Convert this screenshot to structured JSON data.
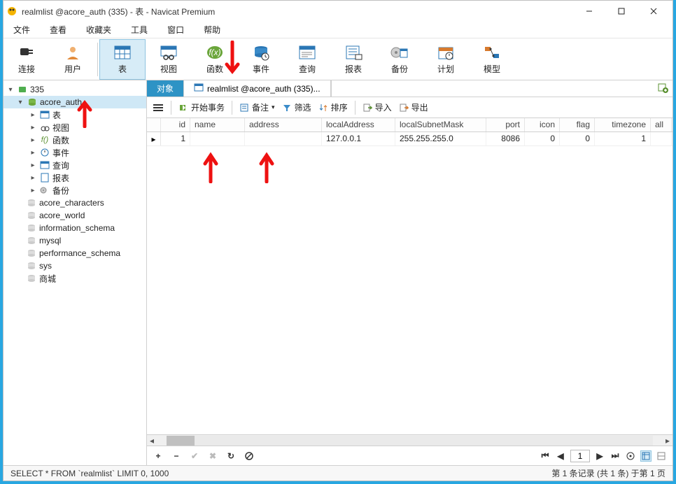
{
  "window": {
    "title": "realmlist @acore_auth (335) - 表 - Navicat Premium"
  },
  "menu": [
    "文件",
    "查看",
    "收藏夹",
    "工具",
    "窗口",
    "帮助"
  ],
  "toolbar": [
    {
      "label": "连接",
      "icon": "connection"
    },
    {
      "label": "用户",
      "icon": "user"
    },
    {
      "label": "表",
      "icon": "table",
      "active": true
    },
    {
      "label": "视图",
      "icon": "view"
    },
    {
      "label": "函数",
      "icon": "fx"
    },
    {
      "label": "事件",
      "icon": "event"
    },
    {
      "label": "查询",
      "icon": "query"
    },
    {
      "label": "报表",
      "icon": "report"
    },
    {
      "label": "备份",
      "icon": "backup"
    },
    {
      "label": "计划",
      "icon": "schedule"
    },
    {
      "label": "模型",
      "icon": "model"
    }
  ],
  "tree": {
    "conn": "335",
    "db_selected": "acore_auth",
    "children": [
      "表",
      "视图",
      "函数",
      "事件",
      "查询",
      "报表",
      "备份"
    ],
    "dbs": [
      "acore_characters",
      "acore_world",
      "information_schema",
      "mysql",
      "performance_schema",
      "sys",
      "商城"
    ]
  },
  "tabs": {
    "t0": "对象",
    "t1": "realmlist @acore_auth (335)..."
  },
  "subtoolbar": {
    "begin_tx": "开始事务",
    "memo": "备注",
    "filter": "筛选",
    "sort": "排序",
    "import": "导入",
    "export": "导出"
  },
  "grid": {
    "columns": [
      "id",
      "name",
      "address",
      "localAddress",
      "localSubnetMask",
      "port",
      "icon",
      "flag",
      "timezone",
      "all"
    ],
    "row0": {
      "id": "1",
      "name": "",
      "address": "",
      "localAddress": "127.0.0.1",
      "localSubnetMask": "255.255.255.0",
      "port": "8086",
      "icon": "0",
      "flag": "0",
      "timezone": "1",
      "all": ""
    }
  },
  "footer": {
    "page": "1"
  },
  "status": {
    "left": "SELECT * FROM `realmlist` LIMIT 0, 1000",
    "right": "第 1 条记录 (共 1 条) 于第 1 页"
  }
}
